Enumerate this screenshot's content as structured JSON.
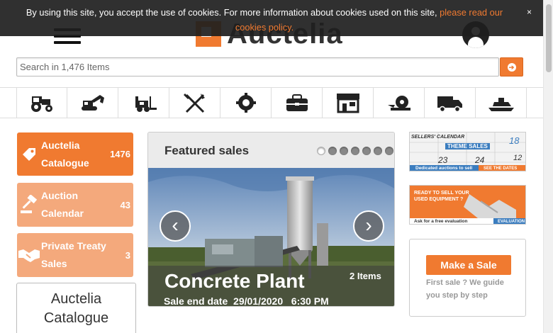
{
  "cookie": {
    "text": "By using this site, you accept the use of cookies. For more information about cookies used on this site, ",
    "link": "please read our cookies policy.",
    "close": "×"
  },
  "header": {
    "logo_text": "Auctelia",
    "brand_color": "#f07a30"
  },
  "search": {
    "placeholder": "Search in 1,476 Items"
  },
  "categories": [
    {
      "icon": "tractor-icon"
    },
    {
      "icon": "excavator-icon"
    },
    {
      "icon": "forklift-icon"
    },
    {
      "icon": "fork-knife-icon"
    },
    {
      "icon": "gear-icon"
    },
    {
      "icon": "toolbox-icon"
    },
    {
      "icon": "shop-icon"
    },
    {
      "icon": "recycling-icon"
    },
    {
      "icon": "truck-icon"
    },
    {
      "icon": "boat-icon"
    }
  ],
  "sidebar": {
    "items": [
      {
        "label": "Auctelia Catalogue",
        "count": "1476",
        "icon": "tag-icon"
      },
      {
        "label": "Auction Calendar",
        "count": "43",
        "icon": "gavel-icon"
      },
      {
        "label": "Private Treaty Sales",
        "count": "3",
        "icon": "handshake-icon"
      }
    ],
    "catalogue_heading": "Auctelia Catalogue"
  },
  "featured": {
    "title": "Featured sales",
    "slide_count": 7,
    "active_slide": 1,
    "slide": {
      "title": "Concrete Plant",
      "items": "2 Items",
      "end_label": "Sale end date",
      "end_date": "29/01/2020",
      "end_time": "6:30 PM"
    },
    "prev": "‹",
    "next": "›"
  },
  "right": {
    "banner1": {
      "heading": "SELLERS' CALENDAR",
      "tag": "THEME SALES",
      "caption": "Dedicated auctions to sell",
      "cta": "SEE THE DATES",
      "numbers": [
        "18",
        "23",
        "24",
        "12"
      ]
    },
    "banner2": {
      "heading": "READY TO SELL YOUR USED EQUIPMENT ?",
      "caption": "Ask for a free evaluation",
      "cta": "EVALUATION"
    },
    "make_sale": {
      "button": "Make a Sale",
      "text": "First sale ? We guide you step by step"
    }
  }
}
